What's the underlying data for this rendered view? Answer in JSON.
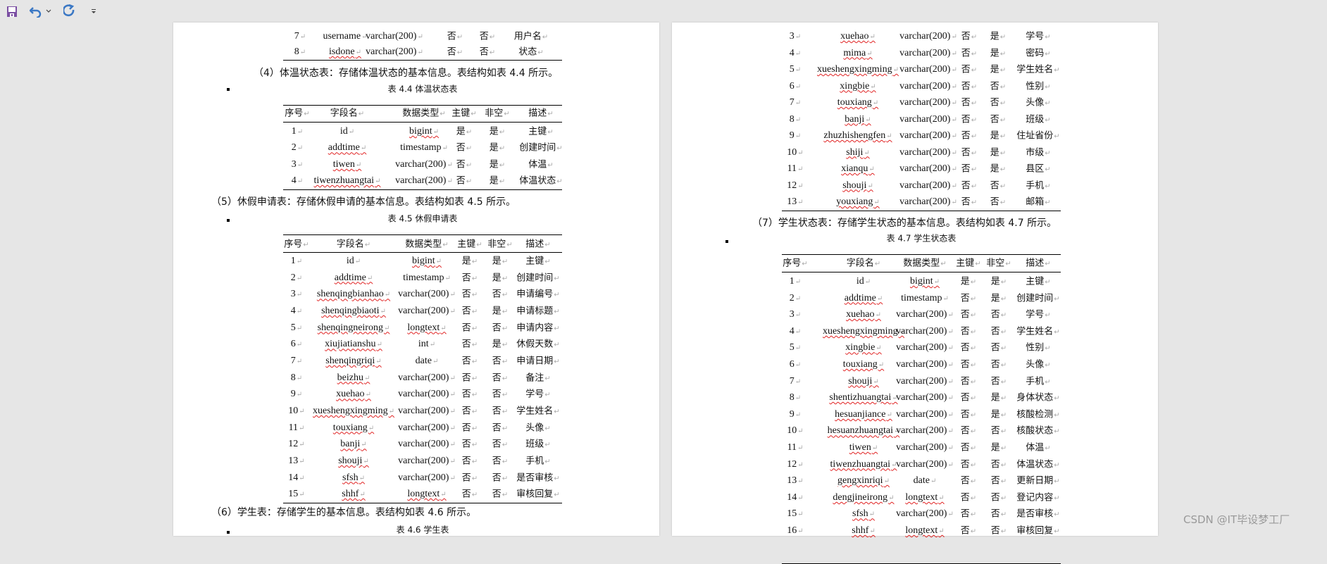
{
  "toolbar": {
    "icons": [
      "save-icon",
      "undo-icon",
      "undo-dropdown-icon",
      "redo-icon",
      "customize-toolbar-icon"
    ]
  },
  "headers": [
    "序号",
    "字段名",
    "数据类型",
    "主键",
    "非空",
    "描述"
  ],
  "left_page": {
    "top_table_rows": [
      [
        "7",
        "username",
        "varchar(200)",
        "否",
        "否",
        "用户名"
      ],
      [
        "8",
        "isdone",
        "varchar(200)",
        "否",
        "否",
        "状态"
      ]
    ],
    "para_4": "（4）体温状态表：存储体温状态的基本信息。表结构如表 4.4 所示。",
    "caption_4_4": "表 4.4   体温状态表",
    "table_4_4": [
      [
        "1",
        "id",
        "bigint",
        "是",
        "是",
        "主键"
      ],
      [
        "2",
        "addtime",
        "timestamp",
        "否",
        "是",
        "创建时间"
      ],
      [
        "3",
        "tiwen",
        "varchar(200)",
        "否",
        "是",
        "体温"
      ],
      [
        "4",
        "tiwenzhuangtai",
        "varchar(200)",
        "否",
        "是",
        "体温状态"
      ]
    ],
    "para_5": "（5）休假申请表：存储休假申请的基本信息。表结构如表 4.5 所示。",
    "caption_4_5": "表 4.5   休假申请表",
    "table_4_5": [
      [
        "1",
        "id",
        "bigint",
        "是",
        "是",
        "主键"
      ],
      [
        "2",
        "addtime",
        "timestamp",
        "否",
        "是",
        "创建时间"
      ],
      [
        "3",
        "shenqingbianhao",
        "varchar(200)",
        "否",
        "否",
        "申请编号"
      ],
      [
        "4",
        "shenqingbiaoti",
        "varchar(200)",
        "否",
        "是",
        "申请标题"
      ],
      [
        "5",
        "shenqingneirong",
        "longtext",
        "否",
        "否",
        "申请内容"
      ],
      [
        "6",
        "xiujiatianshu",
        "int",
        "否",
        "是",
        "休假天数"
      ],
      [
        "7",
        "shenqingriqi",
        "date",
        "否",
        "否",
        "申请日期"
      ],
      [
        "8",
        "beizhu",
        "varchar(200)",
        "否",
        "否",
        "备注"
      ],
      [
        "9",
        "xuehao",
        "varchar(200)",
        "否",
        "否",
        "学号"
      ],
      [
        "10",
        "xueshengxingming",
        "varchar(200)",
        "否",
        "否",
        "学生姓名"
      ],
      [
        "11",
        "touxiang",
        "varchar(200)",
        "否",
        "否",
        "头像"
      ],
      [
        "12",
        "banji",
        "varchar(200)",
        "否",
        "否",
        "班级"
      ],
      [
        "13",
        "shouji",
        "varchar(200)",
        "否",
        "否",
        "手机"
      ],
      [
        "14",
        "sfsh",
        "varchar(200)",
        "否",
        "否",
        "是否审核"
      ],
      [
        "15",
        "shhf",
        "longtext",
        "否",
        "否",
        "审核回复"
      ]
    ],
    "para_6": "（6）学生表：存储学生的基本信息。表结构如表 4.6 所示。",
    "caption_4_6": "表 4.6   学生表"
  },
  "right_page": {
    "table_4_6_rows": [
      [
        "3",
        "xuehao",
        "varchar(200)",
        "否",
        "是",
        "学号"
      ],
      [
        "4",
        "mima",
        "varchar(200)",
        "否",
        "是",
        "密码"
      ],
      [
        "5",
        "xueshengxingming",
        "varchar(200)",
        "否",
        "是",
        "学生姓名"
      ],
      [
        "6",
        "xingbie",
        "varchar(200)",
        "否",
        "否",
        "性别"
      ],
      [
        "7",
        "touxiang",
        "varchar(200)",
        "否",
        "否",
        "头像"
      ],
      [
        "8",
        "banji",
        "varchar(200)",
        "否",
        "否",
        "班级"
      ],
      [
        "9",
        "zhuzhishengfen",
        "varchar(200)",
        "否",
        "是",
        "住址省份"
      ],
      [
        "10",
        "shiji",
        "varchar(200)",
        "否",
        "是",
        "市级"
      ],
      [
        "11",
        "xianqu",
        "varchar(200)",
        "否",
        "是",
        "县区"
      ],
      [
        "12",
        "shouji",
        "varchar(200)",
        "否",
        "否",
        "手机"
      ],
      [
        "13",
        "youxiang",
        "varchar(200)",
        "否",
        "否",
        "邮箱"
      ]
    ],
    "para_7": "（7）学生状态表：存储学生状态的基本信息。表结构如表 4.7 所示。",
    "caption_4_7": "表 4.7   学生状态表",
    "table_4_7": [
      [
        "1",
        "id",
        "bigint",
        "是",
        "是",
        "主键"
      ],
      [
        "2",
        "addtime",
        "timestamp",
        "否",
        "是",
        "创建时间"
      ],
      [
        "3",
        "xuehao",
        "varchar(200)",
        "否",
        "否",
        "学号"
      ],
      [
        "4",
        "xueshengxingming",
        "varchar(200)",
        "否",
        "否",
        "学生姓名"
      ],
      [
        "5",
        "xingbie",
        "varchar(200)",
        "否",
        "否",
        "性别"
      ],
      [
        "6",
        "touxiang",
        "varchar(200)",
        "否",
        "否",
        "头像"
      ],
      [
        "7",
        "shouji",
        "varchar(200)",
        "否",
        "否",
        "手机"
      ],
      [
        "8",
        "shentizhuangtai",
        "varchar(200)",
        "否",
        "是",
        "身体状态"
      ],
      [
        "9",
        "hesuanjiance",
        "varchar(200)",
        "否",
        "是",
        "核酸检测"
      ],
      [
        "10",
        "hesuanzhuangtai",
        "varchar(200)",
        "否",
        "否",
        "核酸状态"
      ],
      [
        "11",
        "tiwen",
        "varchar(200)",
        "否",
        "是",
        "体温"
      ],
      [
        "12",
        "tiwenzhuangtai",
        "varchar(200)",
        "否",
        "否",
        "体温状态"
      ],
      [
        "13",
        "gengxinriqi",
        "date",
        "否",
        "否",
        "更新日期"
      ],
      [
        "14",
        "dengjineirong",
        "longtext",
        "否",
        "否",
        "登记内容"
      ],
      [
        "15",
        "sfsh",
        "varchar(200)",
        "否",
        "否",
        "是否审核"
      ],
      [
        "16",
        "shhf",
        "longtext",
        "否",
        "否",
        "审核回复"
      ]
    ]
  },
  "watermark": "CSDN @IT毕设梦工厂",
  "colors": {
    "background": "#e6e6e6",
    "page": "#ffffff",
    "save_icon": "#7b4fa3",
    "undo_redo": "#3b78c4",
    "spellcheck": "#e02020"
  }
}
